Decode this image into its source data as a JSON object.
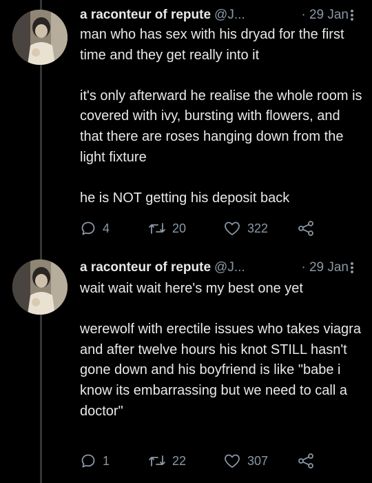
{
  "tweets": [
    {
      "author_name": "a raconteur of repute",
      "handle": "@J...",
      "date": "· 29 Jan",
      "paragraphs": [
        "man who has sex with his dryad for the first time and they get really into it",
        "it's only afterward he realise the whole room is covered with ivy, bursting with flowers, and that there are roses hanging down from the light fixture",
        "he is NOT getting his deposit back"
      ],
      "replies": "4",
      "retweets": "20",
      "likes": "322"
    },
    {
      "author_name": "a raconteur of repute",
      "handle": "@J...",
      "date": "· 29 Jan",
      "paragraphs": [
        "wait wait wait here's my best one yet",
        "werewolf with erectile issues who takes viagra and after twelve hours his knot STILL hasn't gone down and his boyfriend is like \"babe i know its embarrassing but we need to call a doctor\""
      ],
      "replies": "1",
      "retweets": "22",
      "likes": "307"
    }
  ],
  "icons": [
    "avatar",
    "more-vertical-icon",
    "reply-icon",
    "retweet-icon",
    "like-icon",
    "share-icon"
  ],
  "colors": {
    "background": "#000000",
    "text": "#e7e9ea",
    "muted": "#8b98a5",
    "thread_line": "#333639"
  }
}
